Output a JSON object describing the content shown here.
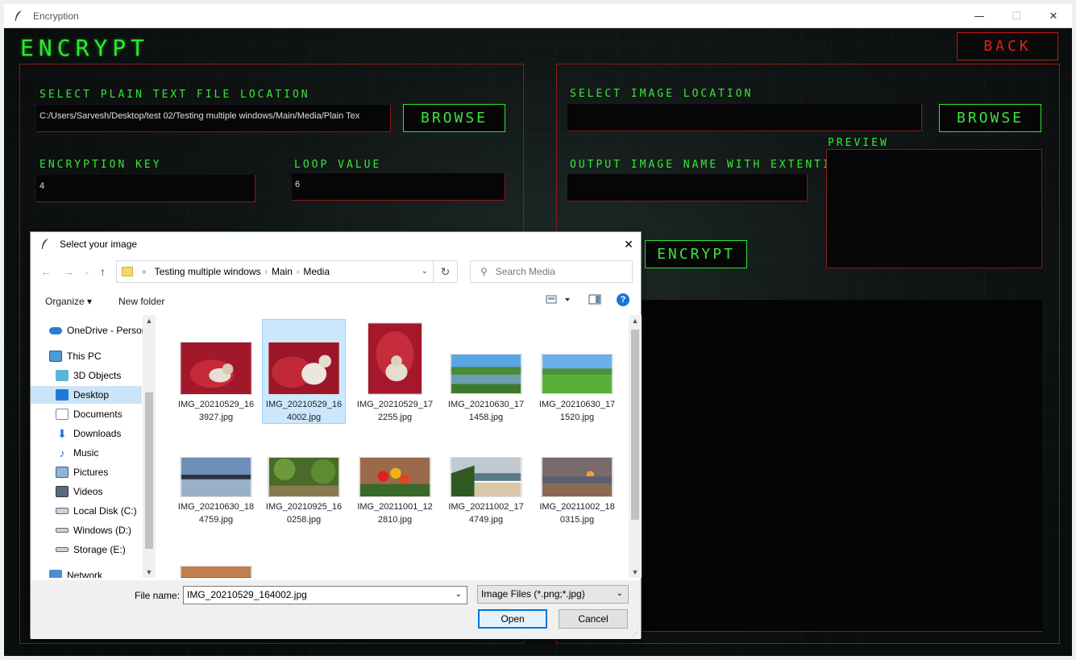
{
  "window": {
    "title": "Encryption",
    "minimize": "—",
    "maximize": "☐",
    "close": "✕"
  },
  "app": {
    "heading": "ENCRYPT",
    "back_label": "BACK",
    "left": {
      "plain_text_label": "SELECT PLAIN TEXT FILE LOCATION",
      "plain_text_value": "C:/Users/Sarvesh/Desktop/test 02/Testing multiple windows/Main/Media/Plain Tex",
      "browse_label": "BROWSE",
      "key_label": "ENCRYPTION KEY",
      "key_value": "4",
      "loop_label": "LOOP VALUE",
      "loop_value": "6"
    },
    "right": {
      "image_label": "SELECT IMAGE LOCATION",
      "image_value": "",
      "browse_label": "BROWSE",
      "output_label": "OUTPUT IMAGE NAME WITH EXTENTION",
      "output_value": "",
      "preview_label": "PREVIEW",
      "encrypt_label": "ENCRYPT"
    },
    "colors": {
      "lcd_green": "#39e639",
      "border_red": "#8a1a1a",
      "back_red": "#e02020"
    }
  },
  "dialog": {
    "title": "Select your image",
    "close": "✕",
    "breadcrumbs": [
      "«",
      "Testing multiple windows",
      "Main",
      "Media"
    ],
    "search_placeholder": "Search Media",
    "organize_label": "Organize ▾",
    "new_folder_label": "New folder",
    "help": "?",
    "sidebar": [
      {
        "label": "OneDrive - Person",
        "icon": "cloud-icon"
      },
      {
        "label": "This PC",
        "icon": "computer-icon"
      },
      {
        "label": "3D Objects",
        "icon": "cube-icon"
      },
      {
        "label": "Desktop",
        "icon": "desktop-icon",
        "selected": true
      },
      {
        "label": "Documents",
        "icon": "document-icon"
      },
      {
        "label": "Downloads",
        "icon": "download-icon"
      },
      {
        "label": "Music",
        "icon": "music-icon"
      },
      {
        "label": "Pictures",
        "icon": "pictures-icon"
      },
      {
        "label": "Videos",
        "icon": "video-icon"
      },
      {
        "label": "Local Disk (C:)",
        "icon": "disk-icon"
      },
      {
        "label": "Windows (D:)",
        "icon": "drive-icon"
      },
      {
        "label": "Storage (E:)",
        "icon": "drive-icon"
      },
      {
        "label": "Network",
        "icon": "network-icon"
      }
    ],
    "files": [
      {
        "line1": "IMG_20210529_16",
        "line2": "3927.jpg",
        "thumb": "cat-red"
      },
      {
        "line1": "IMG_20210529_16",
        "line2": "4002.jpg",
        "thumb": "cat-red",
        "selected": true
      },
      {
        "line1": "IMG_20210529_17",
        "line2": "2255.jpg",
        "thumb": "cat-red-portrait"
      },
      {
        "line1": "IMG_20210630_17",
        "line2": "1458.jpg",
        "thumb": "lake-sky"
      },
      {
        "line1": "IMG_20210630_17",
        "line2": "1520.jpg",
        "thumb": "green-field"
      },
      {
        "line1": "IMG_20210630_18",
        "line2": "4759.jpg",
        "thumb": "sunset-water"
      },
      {
        "line1": "IMG_20210925_16",
        "line2": "0258.jpg",
        "thumb": "jungle"
      },
      {
        "line1": "IMG_20211001_12",
        "line2": "2810.jpg",
        "thumb": "flowers"
      },
      {
        "line1": "IMG_20211002_17",
        "line2": "4749.jpg",
        "thumb": "beach"
      },
      {
        "line1": "IMG_20211002_18",
        "line2": "0315.jpg",
        "thumb": "beach-sunset"
      },
      {
        "line1": "",
        "line2": "",
        "thumb": "sunset-partial"
      }
    ],
    "file_name_label": "File name:",
    "file_name_value": "IMG_20210529_164002.jpg",
    "file_type_value": "Image Files (*.png;*.jpg)",
    "open_label": "Open",
    "cancel_label": "Cancel"
  }
}
